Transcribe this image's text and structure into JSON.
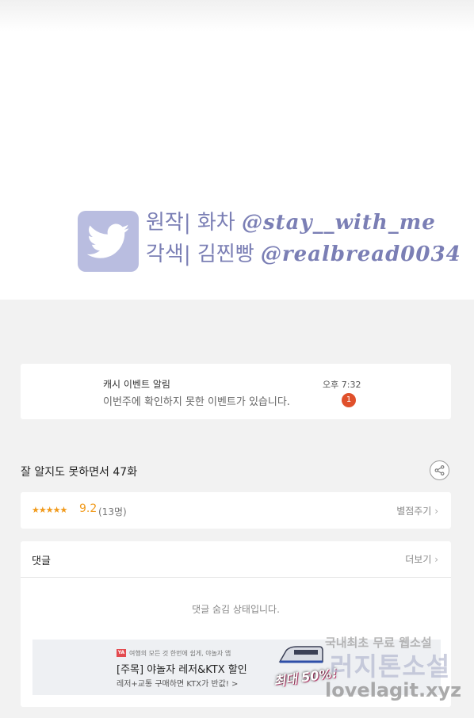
{
  "credit": {
    "line1_label": "원작| 화차",
    "line1_handle": "@stay__with_me",
    "line2_label": "각색| 김찐빵",
    "line2_handle": "@realbread0034",
    "badge_color": "#b9bde0",
    "text_color": "#7b7fb5"
  },
  "notice": {
    "title": "캐시 이벤트 알림",
    "text": "이번주에 확인하지 못한 이벤트가 있습니다.",
    "time": "오후 7:32",
    "badge_count": "1",
    "badge_color": "#e0502b"
  },
  "episode": {
    "title": "잘 알지도 못하면서 47화"
  },
  "rating": {
    "stars_display": "★★★★★",
    "score": "9.2",
    "count": "(13명)",
    "rate_link": "별점주기",
    "accent_color": "#f19a1b"
  },
  "comments": {
    "header": "댓글",
    "more_link": "더보기",
    "hidden_message": "댓글 숨김 상태입니다."
  },
  "ad": {
    "logo_text": "YA",
    "small_text": "여행의 모든 것 한번에 쉽게, 야놀자 앱",
    "title": "[주목] 야놀자 레저&KTX 할인",
    "subtitle": "레저+교통 구매하면 KTX가 반값! >",
    "promo": "최대 50%!"
  },
  "watermark": {
    "line1": "국내최초 무료 웹소설",
    "line2": "러지톤소설",
    "line3": "lovelagit.xyz"
  },
  "icons": {
    "twitter": "twitter-bird-icon",
    "share": "share-icon",
    "chevron": "chevron-right-icon"
  }
}
